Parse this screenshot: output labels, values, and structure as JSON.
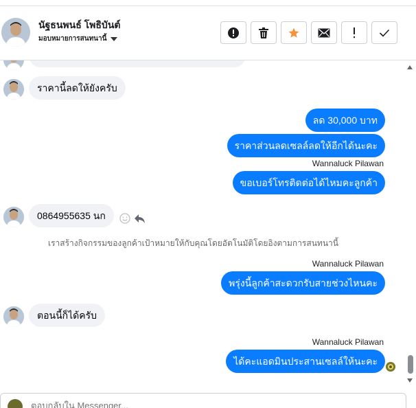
{
  "header": {
    "name": "นัฐธนพนธ์ โพธิบันต์",
    "assign_label": "มอบหมายการสนทนานี้",
    "actions": [
      {
        "icon": "alert-circle-icon",
        "name": "mark-spam-button"
      },
      {
        "icon": "trash-icon",
        "name": "delete-button"
      },
      {
        "icon": "star-icon",
        "name": "star-button"
      },
      {
        "icon": "envelope-icon",
        "name": "mark-unread-button"
      },
      {
        "icon": "exclamation-icon",
        "name": "follow-up-button"
      },
      {
        "icon": "check-icon",
        "name": "done-button"
      }
    ],
    "colors": {
      "star": "#f7923b"
    }
  },
  "messages": {
    "m1": "ราคานี้ลดให้ยังครับ",
    "m2": "ลด 30,000 บาท",
    "m3": "ราคาส่วนลดเซลล์ลดให้อีกได้นะคะ",
    "m3_sender": "Wannaluck Pilawan",
    "m4": "ขอเบอร์โทรติดต่อได้ไหมคะลูกค้า",
    "m5": "0864955635 นก",
    "system": "เราสร้างกิจกรรมของลูกค้าเป้าหมายให้กับคุณโดยอัตโนมัติโดยอิงตามการสนทนานี้",
    "m6_sender": "Wannaluck Pilawan",
    "m6": "พรุ่งนี้ลูกค้าสะดวกรับสายช่วงไหนคะ",
    "m7": "ตอนนี้ก็ได้ครับ",
    "m8_sender": "Wannaluck Pilawan",
    "m8": "ได้คะแอดมินประสานเซลล์ให้นะคะ"
  },
  "colors": {
    "outgoing_bubble": "#0a7cff",
    "incoming_bubble": "#f0f2f5"
  },
  "composer": {
    "placeholder": "ตอบกลับใน Messenger..."
  }
}
